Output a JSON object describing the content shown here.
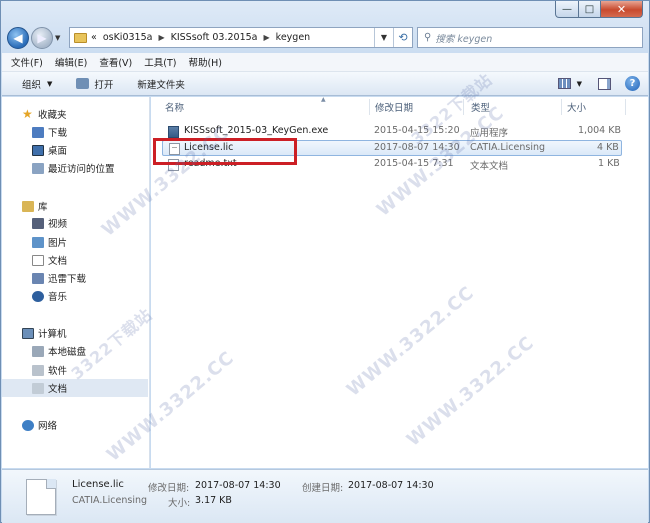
{
  "window": {
    "minimize_glyph": "—",
    "maximize_glyph": "□",
    "close_glyph": "✕"
  },
  "address_bar": {
    "overflow": "«",
    "crumbs": [
      "osKi0315a",
      "KISSsoft 03.2015a",
      "keygen"
    ]
  },
  "search": {
    "placeholder": "搜索 keygen"
  },
  "menu": [
    "文件(F)",
    "编辑(E)",
    "查看(V)",
    "工具(T)",
    "帮助(H)"
  ],
  "toolbar": {
    "organize": "组织",
    "open": "打开",
    "new_folder": "新建文件夹"
  },
  "nav_pane": {
    "favorites": {
      "label": "收藏夹",
      "items": [
        "下载",
        "桌面",
        "最近访问的位置"
      ]
    },
    "libraries": {
      "label": "库",
      "items": [
        "视频",
        "图片",
        "文档",
        "迅雷下载",
        "音乐"
      ]
    },
    "computer": {
      "label": "计算机",
      "items": [
        "本地磁盘",
        "软件",
        "文档"
      ]
    },
    "network": {
      "label": "网络"
    }
  },
  "columns": {
    "name": "名称",
    "modified": "修改日期",
    "type": "类型",
    "size": "大小"
  },
  "files": [
    {
      "name": "KISSsoft_2015-03_KeyGen.exe",
      "modified": "2015-04-15 15:20",
      "type": "应用程序",
      "size": "1,004 KB"
    },
    {
      "name": "License.lic",
      "modified": "2017-08-07 14:30",
      "type": "CATIA.Licensing",
      "size": "4 KB"
    },
    {
      "name": "readme.txt",
      "modified": "2015-04-15 7:31",
      "type": "文本文档",
      "size": "1 KB"
    }
  ],
  "details": {
    "name": "License.lic",
    "type": "CATIA.Licensing",
    "modified_label": "修改日期:",
    "modified_value": "2017-08-07 14:30",
    "created_label": "创建日期:",
    "created_value": "2017-08-07 14:30",
    "size_label": "大小:",
    "size_value": "3.17 KB"
  },
  "watermark": "WWW.3322.CC",
  "watermark_cn": "3322下载站",
  "colors": {
    "highlight_box": "#cc1f25",
    "selection": "#dbe9f8"
  }
}
